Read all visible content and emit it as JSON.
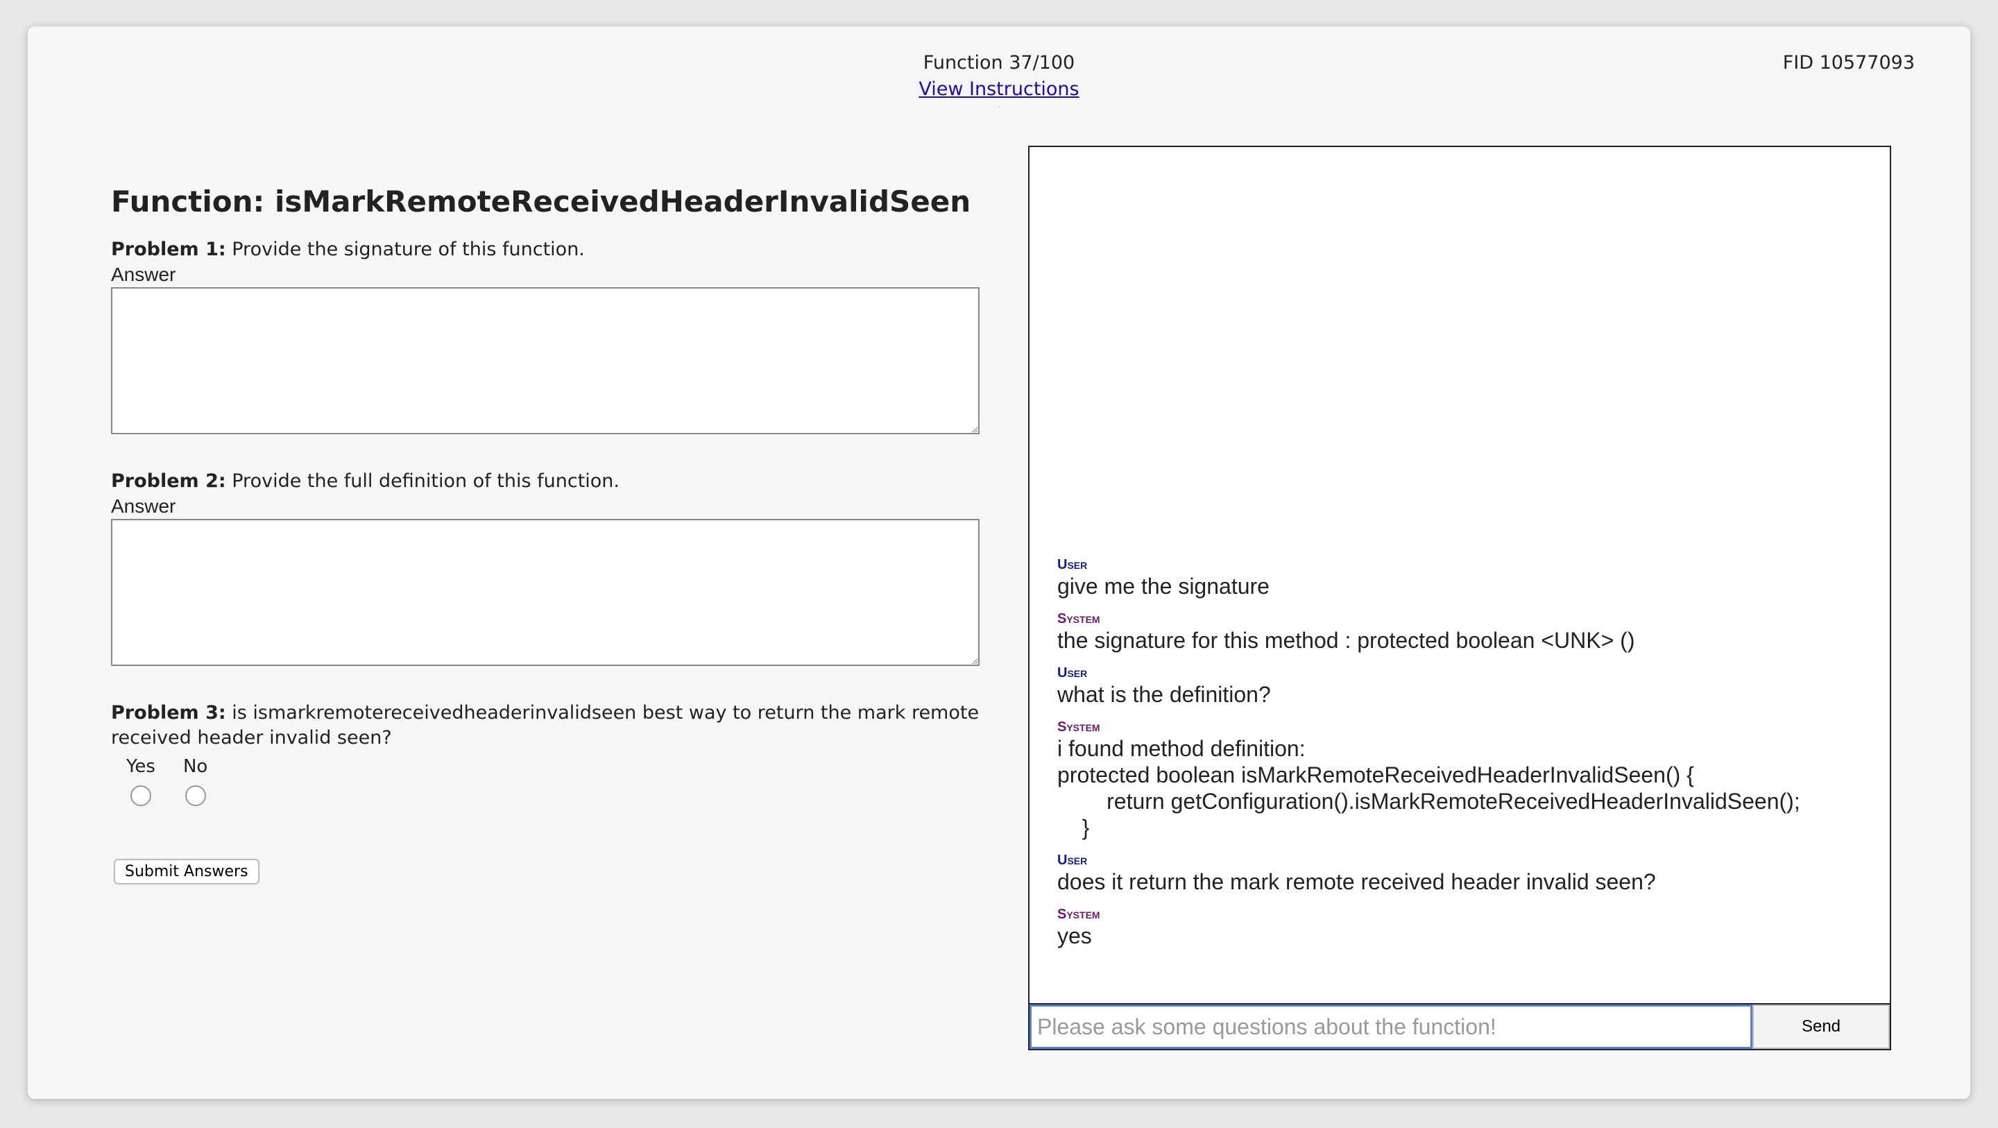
{
  "header": {
    "function_counter": "Function 37/100",
    "instructions_link": "View Instructions",
    "fid": "FID 10577093"
  },
  "main": {
    "function_title": "Function: isMarkRemoteReceivedHeaderInvalidSeen",
    "problems": [
      {
        "label": "Problem 1:",
        "text": " Provide the signature of this function.",
        "answer_label": "Answer",
        "answer_value": ""
      },
      {
        "label": "Problem 2:",
        "text": " Provide the full definition of this function.",
        "answer_label": "Answer",
        "answer_value": ""
      },
      {
        "label": "Problem 3:",
        "text": " is ismarkremotereceivedheaderinvalidseen best way to return the mark remote received header invalid seen?",
        "options": [
          "Yes",
          "No"
        ],
        "selected": null
      }
    ],
    "submit_label": "Submit Answers"
  },
  "chat": {
    "messages": [
      {
        "sender": "User",
        "text": "give me the signature"
      },
      {
        "sender": "System",
        "text": "the signature for this method : protected boolean <UNK> ()"
      },
      {
        "sender": "User",
        "text": "what is the definition?"
      },
      {
        "sender": "System",
        "text": "i found method definition:\nprotected boolean isMarkRemoteReceivedHeaderInvalidSeen() {\n        return getConfiguration().isMarkRemoteReceivedHeaderInvalidSeen();\n    }"
      },
      {
        "sender": "User",
        "text": "does it return the mark remote received header invalid seen?"
      },
      {
        "sender": "System",
        "text": "yes"
      }
    ],
    "input_placeholder": "Please ask some questions about the function!",
    "input_value": "",
    "send_label": "Send"
  },
  "colors": {
    "user_label": "#1a1a8a",
    "system_label": "#6a1a6a",
    "link": "#1a0dab",
    "input_focus": "#5b7fd6"
  }
}
